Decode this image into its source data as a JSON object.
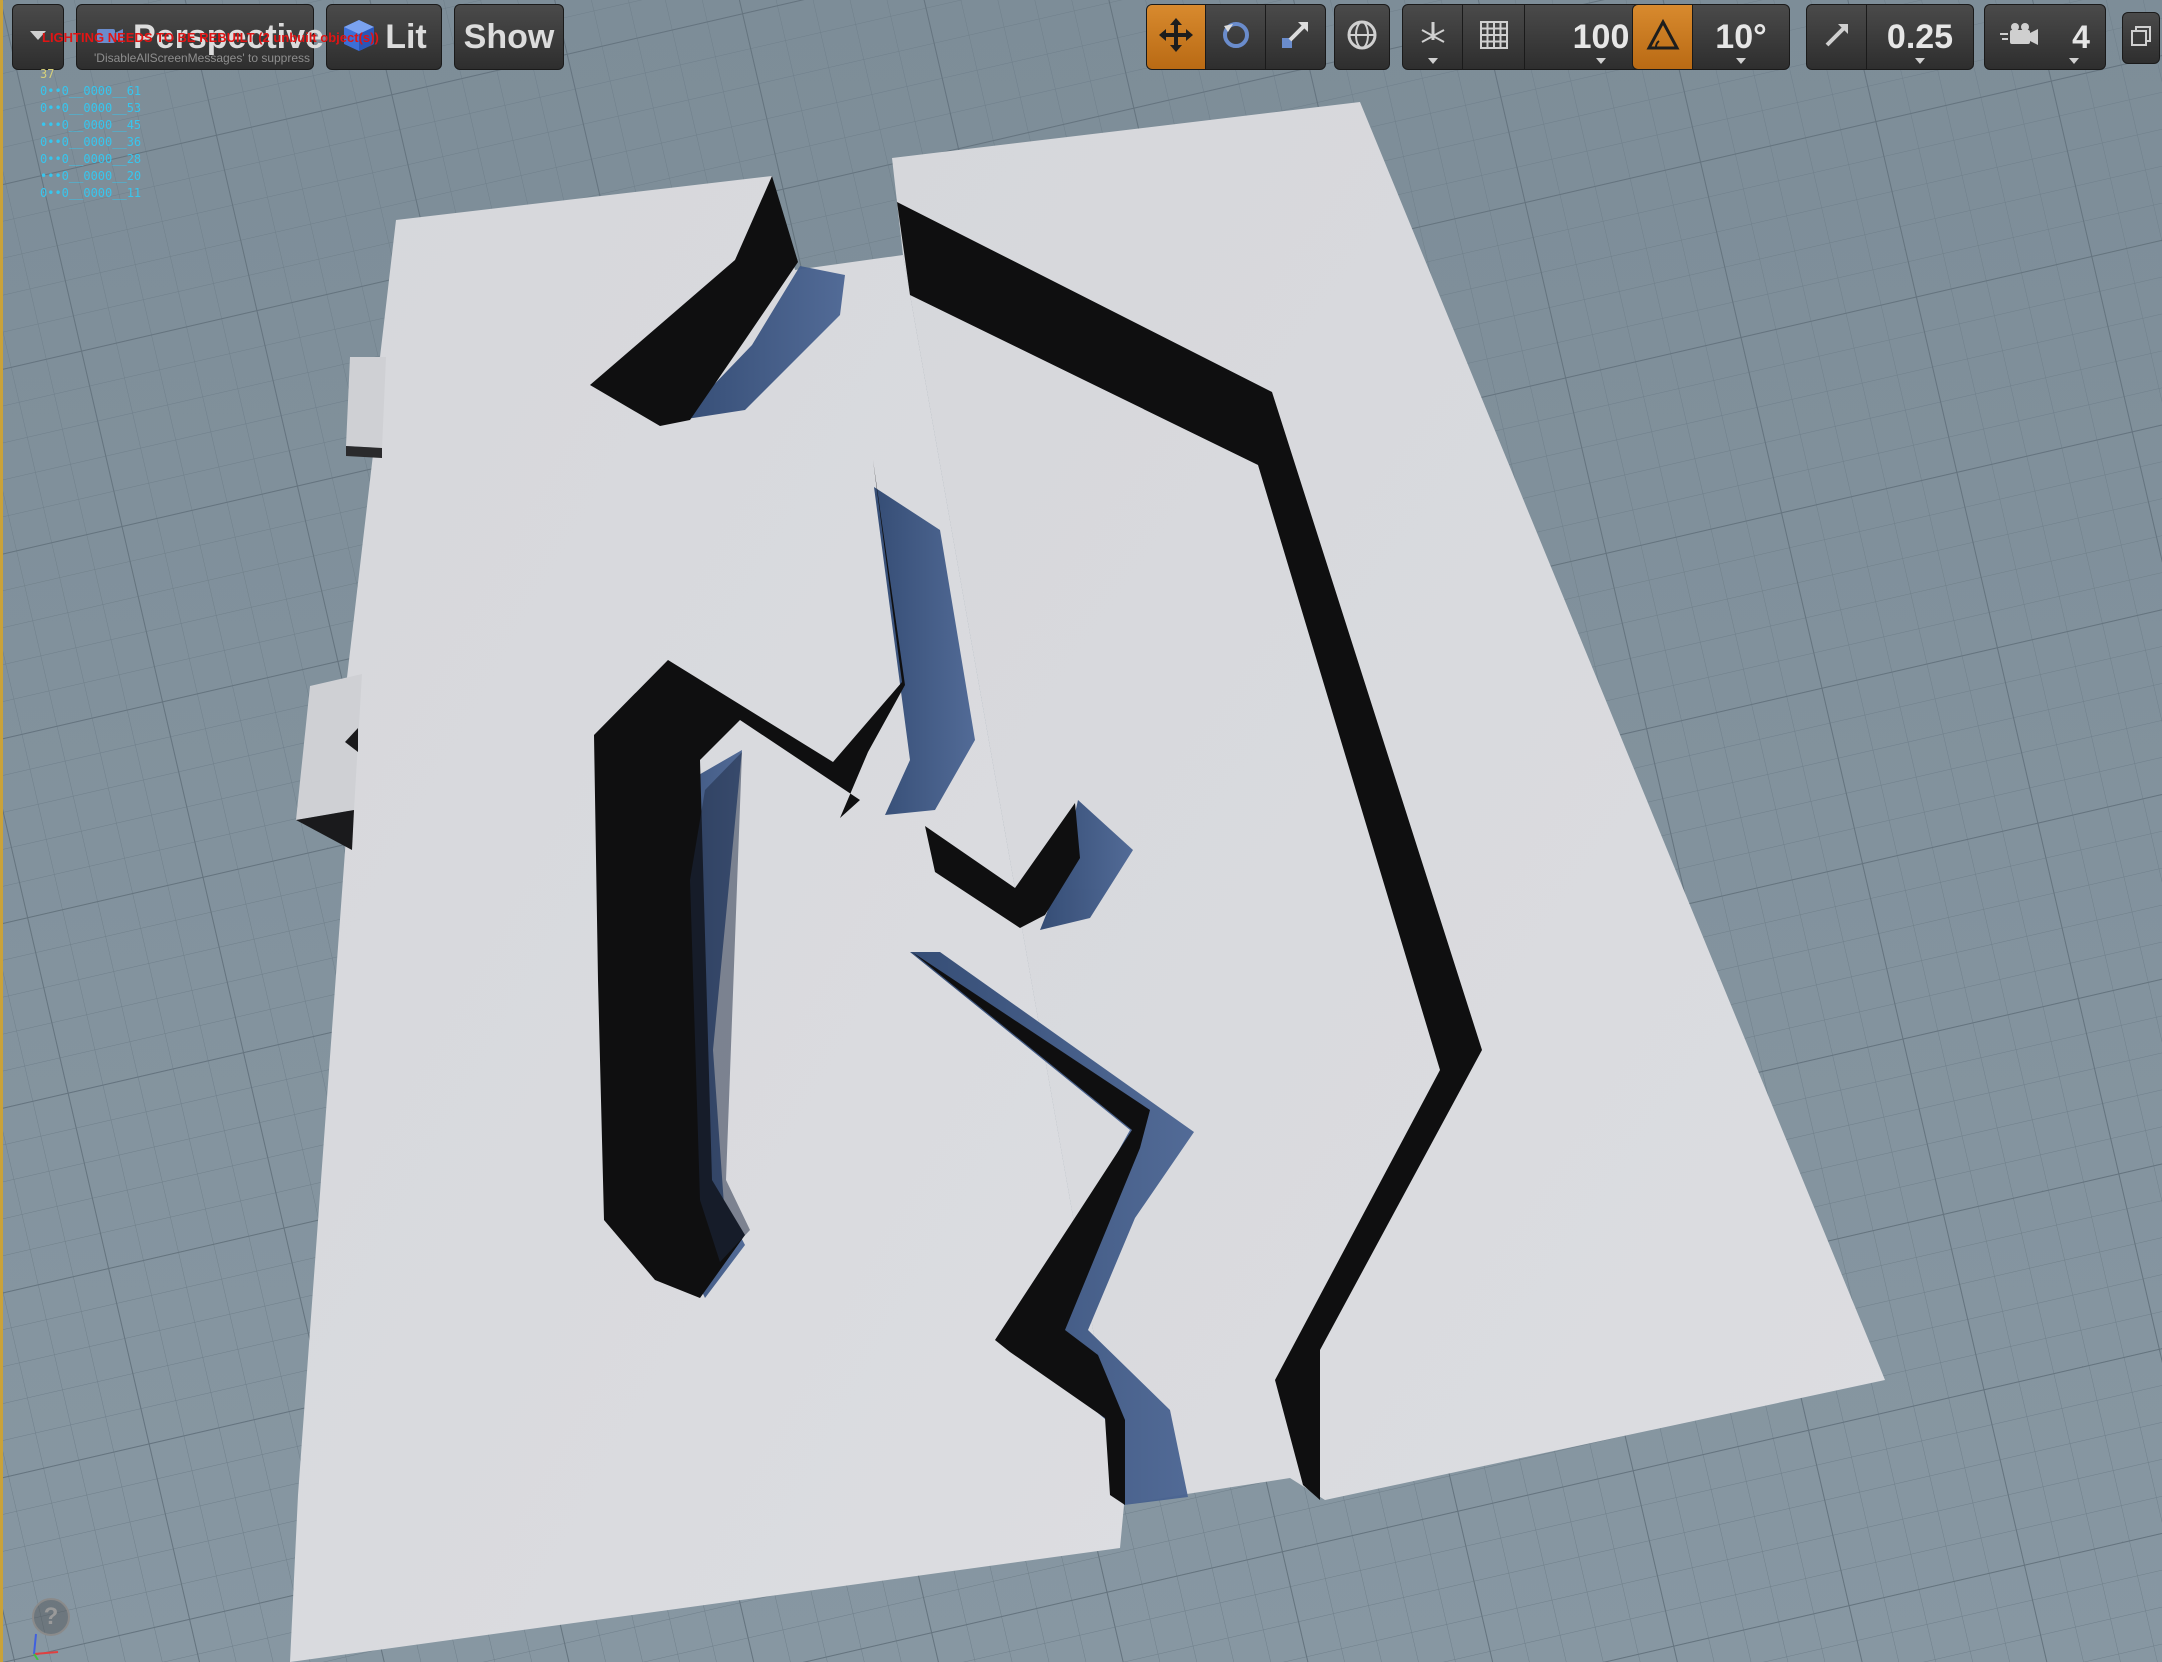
{
  "viewport": {
    "mode_label": "Perspective",
    "view_mode_label": "Lit",
    "show_label": "Show",
    "warning_text": "LIGHTING NEEDS TO BE REBUILT (2 unbuilt object(s))",
    "hint_text": "'DisableAllScreenMessages' to suppress",
    "stats": {
      "count": "37",
      "items": [
        "0••0__0000__61",
        "0••0__0000__53",
        "•••0__0000__45",
        "0••0__0000__36",
        "0••0__0000__28",
        "•••0__0000__20",
        "0••0__0000__11"
      ]
    }
  },
  "toolbar": {
    "grid_snap_value": "100",
    "rotation_snap_value": "10°",
    "scale_snap_value": "0.25",
    "camera_speed_value": "4"
  },
  "icons": {
    "viewport_menu": "chevron-down-icon",
    "perspective": "camera-icon",
    "lit": "lit-cube-icon",
    "translate": "move-icon",
    "rotate": "rotate-icon",
    "scale": "scale-icon",
    "world_local": "globe-icon",
    "surface_snap": "surface-snap-icon",
    "grid_snap": "grid-icon",
    "rotation_snap": "angle-icon",
    "scale_snap": "scale-arrow-icon",
    "camera_speed": "camera-speed-icon",
    "maximize": "maximize-icon",
    "help": "help-icon",
    "axis": "axis-gizmo-icon"
  },
  "colors": {
    "accent_active": "#c7771f",
    "warning": "#e11414",
    "stats_text": "#37c6ee",
    "floor": "#d8d9dd",
    "wall": "#0f0f10",
    "ground": "#7f8f9a",
    "selection_border": "#c9a23a"
  }
}
